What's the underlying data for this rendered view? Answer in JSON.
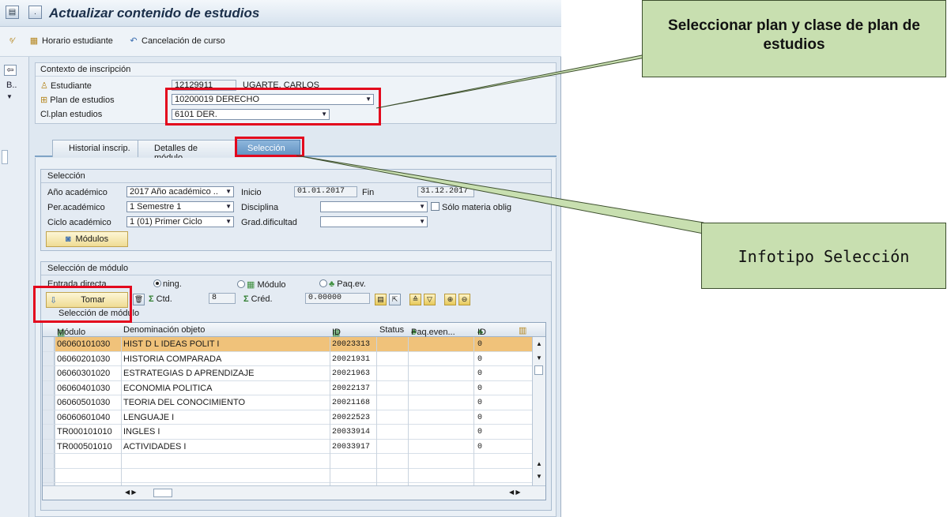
{
  "window": {
    "title": "Actualizar contenido de estudios"
  },
  "toolbar": {
    "horario_label": "Horario estudiante",
    "cancelacion_label": "Cancelación de curso"
  },
  "leftnav": {
    "b_label": "B.."
  },
  "context": {
    "caption": "Contexto de inscripción",
    "estudiante_label": "Estudiante",
    "estudiante_id": "12129911",
    "estudiante_name": "UGARTE, CARLOS",
    "plan_label": "Plan de estudios",
    "plan_value": "10200019 DERECHO",
    "clplan_label": "Cl.plan estudios",
    "clplan_value": "6101 DER."
  },
  "tabs": [
    {
      "label": "Historial inscrip."
    },
    {
      "label": "Detalles de módulo"
    },
    {
      "label": "Selección"
    }
  ],
  "seleccion": {
    "caption": "Selección",
    "ano_label": "Año académico",
    "ano_value": "2017 Año académico ..",
    "inicio_label": "Inicio",
    "inicio_value": "01.01.2017",
    "fin_label": "Fin",
    "fin_value": "31.12.2017",
    "peracad_label": "Per.académico",
    "peracad_value": "1 Semestre 1",
    "disciplina_label": "Disciplina",
    "disciplina_value": "",
    "solo_label": "Sólo materia oblig",
    "ciclo_label": "Ciclo académico",
    "ciclo_value": "1 (01) Primer Ciclo",
    "grad_label": "Grad.dificultad",
    "grad_value": "",
    "modulos_button": "Módulos"
  },
  "seleccion_modulo": {
    "caption": "Selección de módulo",
    "entrada_label": "Entrada directa",
    "radio1_label": "ning.",
    "radio2_label": "Módulo",
    "radio3_label": "Paq.ev.",
    "tomar_button": "Tomar",
    "ctd_label": "Ctd.",
    "ctd_value": "8",
    "cred_label": "Créd.",
    "cred_value": "0.00000",
    "grid_title": "Selección de módulo"
  },
  "grid": {
    "columns": [
      "Módulo",
      "Denominación objeto",
      "ID",
      "Status",
      "Paq.even...",
      "ID"
    ],
    "rows": [
      {
        "modulo": "06060101030",
        "denom": "HIST D L IDEAS POLIT I",
        "id": "20023313",
        "status": "",
        "paq": "",
        "id2": "0"
      },
      {
        "modulo": "06060201030",
        "denom": "HISTORIA COMPARADA",
        "id": "20021931",
        "status": "",
        "paq": "",
        "id2": "0"
      },
      {
        "modulo": "06060301020",
        "denom": "ESTRATEGIAS D APRENDIZAJE",
        "id": "20021963",
        "status": "",
        "paq": "",
        "id2": "0"
      },
      {
        "modulo": "06060401030",
        "denom": "ECONOMIA POLITICA",
        "id": "20022137",
        "status": "",
        "paq": "",
        "id2": "0"
      },
      {
        "modulo": "06060501030",
        "denom": "TEORIA DEL CONOCIMIENTO",
        "id": "20021168",
        "status": "",
        "paq": "",
        "id2": "0"
      },
      {
        "modulo": "06060601040",
        "denom": "LENGUAJE I",
        "id": "20022523",
        "status": "",
        "paq": "",
        "id2": "0"
      },
      {
        "modulo": "TR000101010",
        "denom": "INGLES I",
        "id": "20033914",
        "status": "",
        "paq": "",
        "id2": "0"
      },
      {
        "modulo": "TR000501010",
        "denom": "ACTIVIDADES I",
        "id": "20033917",
        "status": "",
        "paq": "",
        "id2": "0"
      }
    ]
  },
  "callouts": {
    "top": "Seleccionar plan y clase de plan de estudios",
    "middle": "Infotipo Selección"
  },
  "colors": {
    "highlight_row": "#f0c27a",
    "callout_bg": "#c8dfb0",
    "annotation_red": "#e3071d",
    "active_tab": "#5e8fbf"
  }
}
